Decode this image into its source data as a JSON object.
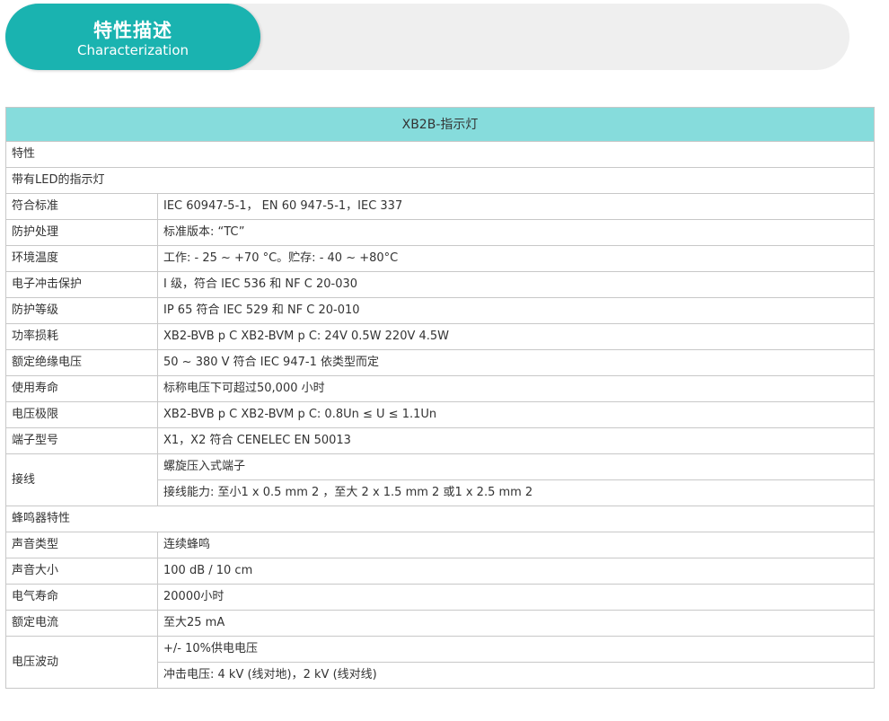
{
  "banner": {
    "title": "特性描述",
    "subtitle": "Characterization"
  },
  "table": {
    "header": "XB2B-指示灯",
    "section1": "特性",
    "section1_sub": "带有LED的指示灯",
    "rows1": [
      {
        "label": "符合标准",
        "value": "IEC 60947-5-1， EN 60 947-5-1，IEC 337"
      },
      {
        "label": "防护处理",
        "value": "标准版本: “TC”"
      },
      {
        "label": "环境温度",
        "value": "工作: - 25 ~ +70 °C。贮存: - 40 ~ +80°C"
      },
      {
        "label": "电子冲击保护",
        "value": "I 级，符合 IEC 536 和 NF C 20-030"
      },
      {
        "label": "防护等级",
        "value": "IP 65 符合 IEC 529 和 NF C 20-010"
      },
      {
        "label": "功率损耗",
        "value": "XB2-BVB p C XB2-BVM p C: 24V 0.5W 220V 4.5W"
      },
      {
        "label": "额定绝缘电压",
        "value": "50 ~ 380 V 符合 IEC 947-1 依类型而定"
      },
      {
        "label": "使用寿命",
        "value": "标称电压下可超过50,000 小时"
      },
      {
        "label": "电压极限",
        "value": "XB2-BVB p C XB2-BVM p C: 0.8Un ≤ U ≤ 1.1Un"
      },
      {
        "label": "端子型号",
        "value": "X1，X2 符合 CENELEC EN 50013"
      }
    ],
    "wiring": {
      "label": "接线",
      "value1": "螺旋压入式端子",
      "value2": "接线能力: 至小1 x 0.5 mm 2 ，至大 2 x 1.5 mm 2 或1 x 2.5 mm 2"
    },
    "section2": "蜂鸣器特性",
    "rows2": [
      {
        "label": "声音类型",
        "value": "连续蜂鸣"
      },
      {
        "label": "声音大小",
        "value": "100 dB / 10 cm"
      },
      {
        "label": "电气寿命",
        "value": "20000小时"
      },
      {
        "label": "额定电流",
        "value": "至大25 mA"
      }
    ],
    "voltage_fluct": {
      "label": "电压波动",
      "value1": "+/- 10%供电电压",
      "value2": "冲击电压: 4 kV (线对地)，2 kV (线对线)"
    }
  },
  "colors": {
    "accent": "#1ab3b0",
    "header_bg": "#86dcdc",
    "banner_bg": "#efefef",
    "border": "#c8c8c8"
  }
}
